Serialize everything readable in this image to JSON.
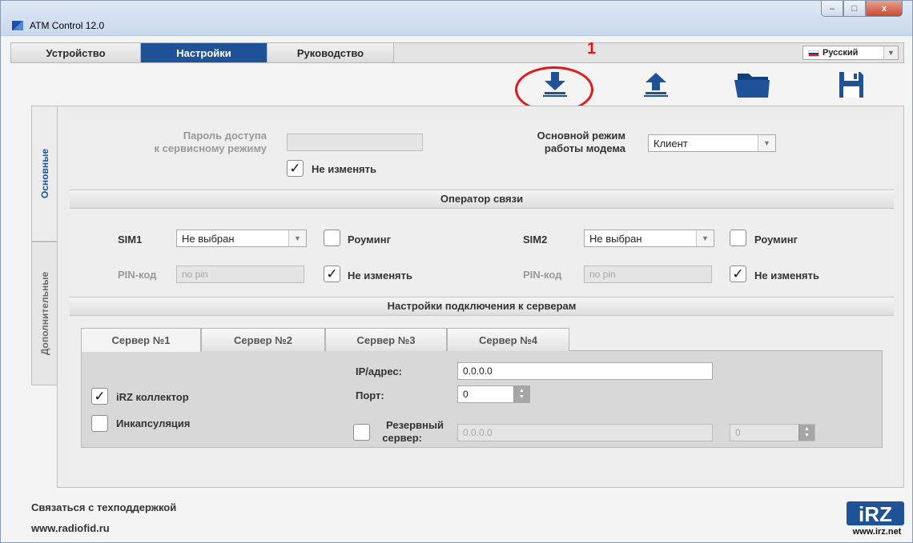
{
  "window": {
    "title": "ATM Control 12.0",
    "minimize": "–",
    "maximize": "□",
    "close": "x"
  },
  "topnav": {
    "tabs": [
      {
        "label": "Устройство"
      },
      {
        "label": "Настройки",
        "active": true
      },
      {
        "label": "Руководство"
      }
    ],
    "language": {
      "value": "Русский",
      "arrow": "▼"
    }
  },
  "toolbar": {
    "download_icon": "download-icon",
    "upload_icon": "upload-icon",
    "folder_icon": "folder-icon",
    "save_icon": "save-icon",
    "annotation_number": "1",
    "accent_color": "#1f5297"
  },
  "side_tabs": [
    {
      "label": "Основные",
      "active": true
    },
    {
      "label": "Дополнительные"
    }
  ],
  "main": {
    "password_label_1": "Пароль доступа",
    "password_label_2": "к сервисному режиму",
    "password_value": "",
    "password_no_change": "Не изменять",
    "mode_label_1": "Основной режим",
    "mode_label_2": "работы модема",
    "mode_value": "Клиент"
  },
  "operator": {
    "title": "Оператор связи",
    "sim1": {
      "label": "SIM1",
      "value": "Не выбран",
      "roaming": "Роуминг",
      "pin_label": "PIN-код",
      "pin_placeholder": "no pin",
      "no_change": "Не изменять"
    },
    "sim2": {
      "label": "SIM2",
      "value": "Не выбран",
      "roaming": "Роуминг",
      "pin_label": "PIN-код",
      "pin_placeholder": "no pin",
      "no_change": "Не изменять"
    }
  },
  "servers": {
    "title": "Настройки подключения к серверам",
    "tabs": [
      {
        "label": "Сервер №1",
        "active": true
      },
      {
        "label": "Сервер №2"
      },
      {
        "label": "Сервер №3"
      },
      {
        "label": "Сервер №4"
      }
    ],
    "ip_label": "IP/адрес:",
    "ip_value": "0.0.0.0",
    "port_label": "Порт:",
    "port_value": "0",
    "irz_collector": "iRZ коллектор",
    "encapsulation": "Инкапсуляция",
    "backup_label_1": "Резервный",
    "backup_label_2": "сервер:",
    "backup_ip": "0.0.0.0",
    "backup_port": "0"
  },
  "footer": {
    "support": "Связаться с техподдержкой",
    "site": "www.radiofid.ru",
    "logo_text": "iRZ",
    "logo_url_text": "www.irz.net"
  }
}
